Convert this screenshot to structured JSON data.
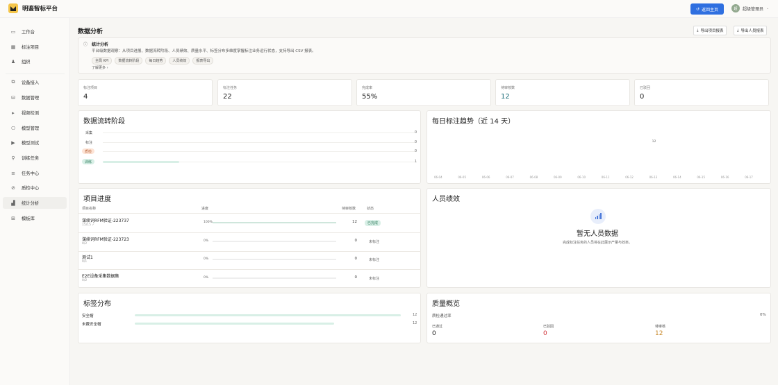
{
  "app": {
    "name": "明鉴智标平台",
    "back_label": "返回主页",
    "user_name": "超级管理员",
    "avatar": "超"
  },
  "colors": {
    "primary": "#2f6fe0",
    "success": "#2e8b57",
    "danger": "#d0353b",
    "warning": "#c8892b",
    "teal": "#1e6f7a"
  },
  "sidebar": {
    "items": [
      {
        "label": "工作台",
        "icon": "monitor-icon"
      },
      {
        "label": "标注项目",
        "icon": "grid-icon"
      },
      {
        "label": "组织",
        "icon": "user-icon"
      },
      {
        "label": "设备接入",
        "icon": "device-icon"
      },
      {
        "label": "数据管理",
        "icon": "database-icon"
      },
      {
        "label": "视频检测",
        "icon": "play-icon"
      },
      {
        "label": "模型管理",
        "icon": "model-icon"
      },
      {
        "label": "模型测试",
        "icon": "test-icon"
      },
      {
        "label": "训练任务",
        "icon": "task-icon"
      },
      {
        "label": "任务中心",
        "icon": "list-icon"
      },
      {
        "label": "质检中心",
        "icon": "check-icon"
      },
      {
        "label": "统计分析",
        "icon": "chart-icon"
      },
      {
        "label": "模板库",
        "icon": "template-icon"
      }
    ]
  },
  "page": {
    "title": "数据分析",
    "export_project": "导出项目报表",
    "export_people": "导出人员报表"
  },
  "info": {
    "title": "统计分析",
    "desc": "平台级数据观察：从项目进展、数据流转阶段、人员绩效、质量水平、标签分布多维度掌握标注业务运行状态，支持导出 CSV 报表。",
    "tags": [
      "全局 KPI",
      "数据流转阶段",
      "每日趋势",
      "人员绩效",
      "报表导出"
    ],
    "more": "了解更多 ›"
  },
  "stats": [
    {
      "label": "标注项目",
      "value": "4",
      "color": "#222"
    },
    {
      "label": "标注任务",
      "value": "22",
      "color": "#222"
    },
    {
      "label": "完成率",
      "value": "55%",
      "color": "#222"
    },
    {
      "label": "待审核数",
      "value": "12",
      "color": "#1e6f7a"
    },
    {
      "label": "已驳回",
      "value": "0",
      "color": "#222"
    }
  ],
  "flow": {
    "title": "数据流转阶段",
    "stages": [
      {
        "label": "采集",
        "count": "0",
        "pill": false,
        "ratio": 0
      },
      {
        "label": "标注",
        "count": "0",
        "pill": false,
        "ratio": 0
      },
      {
        "label": "质检",
        "count": "0",
        "pill": true,
        "pill_bg": "#fde4d6",
        "pill_color": "#b8653a",
        "ratio": 0
      },
      {
        "label": "训练",
        "count": "1",
        "pill": true,
        "pill_bg": "#d8efe6",
        "pill_color": "#2f7c5e",
        "ratio": 0.25
      }
    ]
  },
  "trend": {
    "title": "每日标注趋势（近 14 天）",
    "dates": [
      "06-04",
      "06-05",
      "06-06",
      "06-07",
      "06-08",
      "06-09",
      "06-10",
      "06-11",
      "06-12",
      "06-13",
      "06-14",
      "06-15",
      "06-16",
      "06-17"
    ],
    "values": [
      0,
      0,
      0,
      0,
      0,
      0,
      0,
      0,
      0,
      12,
      0,
      0,
      0,
      0
    ]
  },
  "progress": {
    "title": "项目进度",
    "headers": {
      "name": "项目名称",
      "progress": "进度",
      "pending": "待审核数",
      "status": "状态"
    },
    "rows": [
      {
        "name": "谋续词RFM验证-223737",
        "sub": "15/15 ✓",
        "pct": "100%",
        "ratio": 1.0,
        "pending": "12",
        "status": "已完成",
        "status_type": "done"
      },
      {
        "name": "谋续词RFM验证-223723",
        "sub": "0/2",
        "pct": "0%",
        "ratio": 0,
        "pending": "0",
        "status": "未标注",
        "status_type": "none"
      },
      {
        "name": "测试1",
        "sub": "0/1",
        "pct": "0%",
        "ratio": 0,
        "pending": "0",
        "status": "未标注",
        "status_type": "none"
      },
      {
        "name": "E2E设备采集数据集",
        "sub": "0/2",
        "pct": "0%",
        "ratio": 0,
        "pending": "0",
        "status": "未标注",
        "status_type": "none"
      }
    ]
  },
  "people": {
    "title": "人员绩效",
    "empty_title": "暂无人员数据",
    "empty_desc": "完成标注任务的人员将在此展示产量与效率。"
  },
  "labels": {
    "title": "标签分布",
    "items": [
      {
        "name": "安全帽",
        "count": "12",
        "ratio": 1.0
      },
      {
        "name": "未戴安全帽",
        "count": "12",
        "ratio": 0.75
      }
    ]
  },
  "quality": {
    "title": "质量概览",
    "rate_label": "质检通过率",
    "rate_value": "0%",
    "items": [
      {
        "label": "已通过",
        "value": "0",
        "color": "#222"
      },
      {
        "label": "已驳回",
        "value": "0",
        "color": "#d0353b"
      },
      {
        "label": "待审核",
        "value": "12",
        "color": "#c8892b"
      }
    ]
  }
}
